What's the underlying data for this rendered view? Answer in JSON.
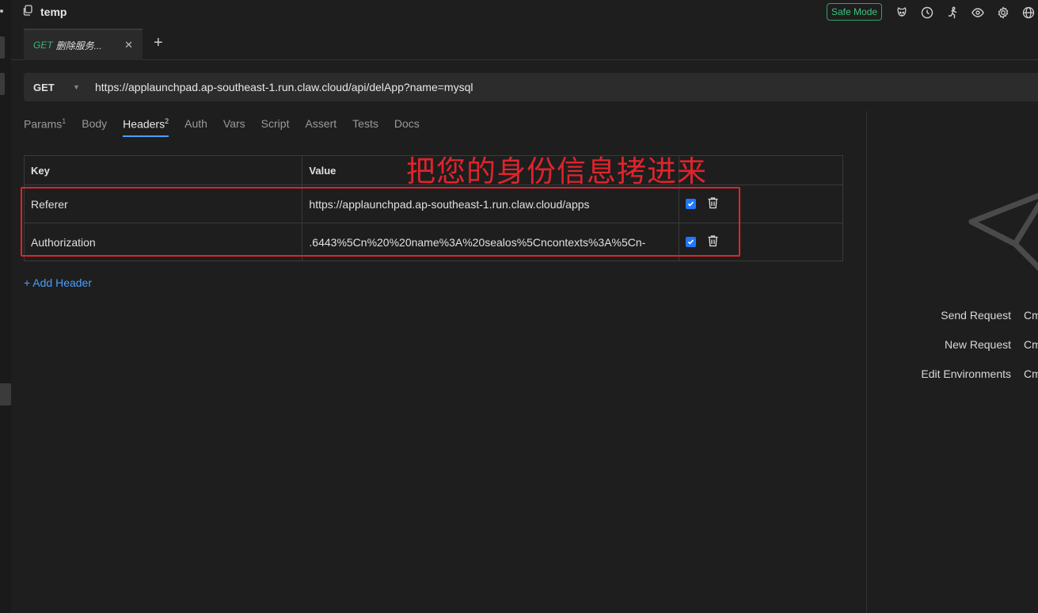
{
  "collection": {
    "icon": "copy-icon",
    "name": "temp"
  },
  "top_bar": {
    "safe_mode_label": "Safe Mode",
    "icons": [
      "cookie-icon",
      "history-icon",
      "runner-icon",
      "eye-icon",
      "gear-icon",
      "globe-icon"
    ]
  },
  "tabs": [
    {
      "method": "GET",
      "title": "删除服务...",
      "close_icon": "close-icon"
    }
  ],
  "new_tab_icon": "+",
  "request": {
    "method": "GET",
    "url": "https://applaunchpad.ap-southeast-1.run.claw.cloud/api/delApp?name=mysql"
  },
  "subtabs": [
    {
      "label": "Params",
      "badge": "1"
    },
    {
      "label": "Body",
      "badge": ""
    },
    {
      "label": "Headers",
      "badge": "2",
      "active": true
    },
    {
      "label": "Auth",
      "badge": ""
    },
    {
      "label": "Vars",
      "badge": ""
    },
    {
      "label": "Script",
      "badge": ""
    },
    {
      "label": "Assert",
      "badge": ""
    },
    {
      "label": "Tests",
      "badge": ""
    },
    {
      "label": "Docs",
      "badge": ""
    }
  ],
  "headers_table": {
    "columns": [
      "Key",
      "Value"
    ],
    "rows": [
      {
        "key": "Referer",
        "value": "https://applaunchpad.ap-southeast-1.run.claw.cloud/apps",
        "enabled": true
      },
      {
        "key": "Authorization",
        "value": ".6443%5Cn%20%20name%3A%20sealos%5Cncontexts%3A%5Cn-",
        "enabled": true
      }
    ]
  },
  "add_header_label": "+ Add Header",
  "annotation_text": "把您的身份信息拷进来",
  "annotation_color": "#e0242c",
  "shortcuts": [
    {
      "label": "Send Request",
      "key": "Cm"
    },
    {
      "label": "New Request",
      "key": "Cm"
    },
    {
      "label": "Edit Environments",
      "key": "Cm"
    }
  ],
  "accent_color": "#4a9eff"
}
